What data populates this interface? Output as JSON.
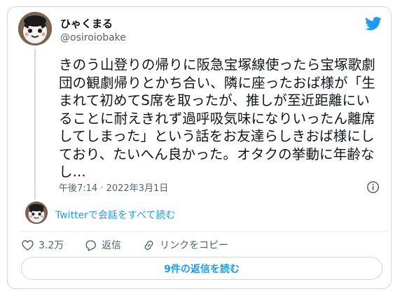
{
  "author": {
    "display_name": "ひゃくまる",
    "handle": "@osiroiobake"
  },
  "tweet": {
    "lines": [
      "きのう山登りの帰りに阪急宝塚線使ったら宝塚歌劇",
      "団の観劇帰りとかち合い、隣に座ったおば様が「生",
      "まれて初めてS席を取ったが、推しが至近距離にい",
      "ることに耐えきれず過呼吸気味になりいったん離席",
      "してしまった」という話をお友達らしきおば様にし",
      "ており、たいへん良かった。オタクの挙動に年齢な",
      "し..."
    ],
    "timestamp": "午後7:14 · 2022年3月1日"
  },
  "thread_link": "Twitterで会話をすべて読む",
  "actions": {
    "like_count": "3.2万",
    "reply_label": "返信",
    "copy_link_label": "リンクをコピー"
  },
  "replies_button": "9件の返信を読む",
  "colors": {
    "accent": "#1d9bf0",
    "secondary_text": "#536471",
    "border": "#cfd9de"
  },
  "icons": [
    "twitter-bird-icon",
    "info-icon",
    "heart-icon",
    "reply-bubble-icon",
    "link-icon"
  ]
}
